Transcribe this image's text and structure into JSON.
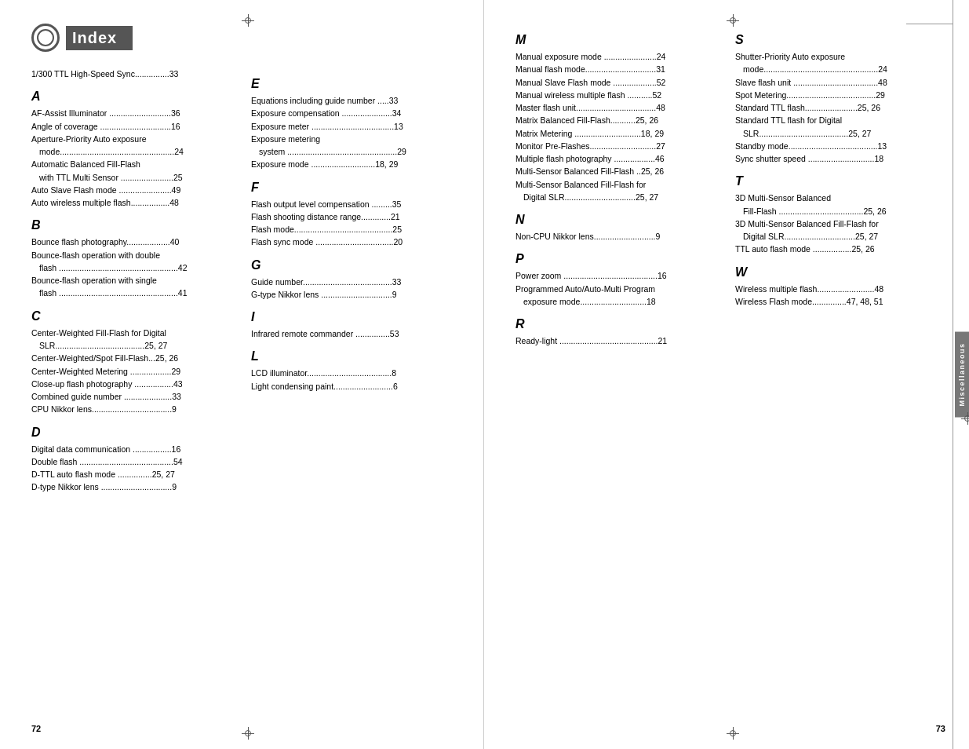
{
  "leftPage": {
    "pageNum": "72",
    "header": {
      "title": "Index",
      "icon": "index-icon"
    },
    "col1": {
      "topEntry": {
        "text": "1/300 TTL High-Speed Sync",
        "page": "33"
      },
      "sections": [
        {
          "letter": "A",
          "entries": [
            {
              "text": "AF-Assist Illuminator ",
              "dots": true,
              "page": "36"
            },
            {
              "text": "Angle of coverage ",
              "dots": true,
              "page": "16"
            },
            {
              "text": "Aperture-Priority Auto exposure mode",
              "dots": true,
              "page": "24",
              "wrap": true
            },
            {
              "text": "Automatic Balanced Fill-Flash with TTL Multi Sensor ",
              "dots": true,
              "page": "25",
              "wrap": true
            },
            {
              "text": "Auto Slave Flash mode ",
              "dots": true,
              "page": "49"
            },
            {
              "text": "Auto wireless multiple flash",
              "dots": true,
              "page": "48"
            }
          ]
        },
        {
          "letter": "B",
          "entries": [
            {
              "text": "Bounce flash photography",
              "dots": true,
              "page": "40"
            },
            {
              "text": "Bounce-flash operation with double flash ",
              "dots": true,
              "page": "42",
              "wrap": true
            },
            {
              "text": "Bounce-flash operation with single flash ",
              "dots": true,
              "page": "41",
              "wrap": true
            }
          ]
        },
        {
          "letter": "C",
          "entries": [
            {
              "text": "Center-Weighted Fill-Flash for Digital SLR",
              "dots": true,
              "page": "25, 27",
              "wrap": true
            },
            {
              "text": "Center-Weighted/Spot Fill-Flash",
              "dots": true,
              "page": "25, 26"
            },
            {
              "text": "Center-Weighted Metering ",
              "dots": true,
              "page": "29"
            },
            {
              "text": "Close-up flash photography ",
              "dots": true,
              "page": "43"
            },
            {
              "text": "Combined guide number ",
              "dots": true,
              "page": "33"
            },
            {
              "text": "CPU Nikkor lens",
              "dots": true,
              "page": "9"
            }
          ]
        },
        {
          "letter": "D",
          "entries": [
            {
              "text": "Digital data communication ",
              "dots": true,
              "page": "16"
            },
            {
              "text": "Double flash ",
              "dots": true,
              "page": "54"
            },
            {
              "text": "D-TTL auto flash mode ",
              "dots": true,
              "page": "25, 27"
            },
            {
              "text": "D-type Nikkor lens ",
              "dots": true,
              "page": "9"
            }
          ]
        }
      ]
    },
    "col2": {
      "sections": [
        {
          "letter": "E",
          "entries": [
            {
              "text": "Equations including guide number ",
              "dots": true,
              "page": "33"
            },
            {
              "text": "Exposure compensation ",
              "dots": true,
              "page": "34"
            },
            {
              "text": "Exposure meter ",
              "dots": true,
              "page": "13"
            },
            {
              "text": "Exposure metering system ",
              "dots": true,
              "page": "29",
              "wrap": true
            },
            {
              "text": "Exposure mode",
              "dots": true,
              "page": "18, 29"
            }
          ]
        },
        {
          "letter": "F",
          "entries": [
            {
              "text": "Flash output level compensation ",
              "dots": true,
              "page": "35"
            },
            {
              "text": "Flash shooting distance range",
              "dots": true,
              "page": "21"
            },
            {
              "text": "Flash mode",
              "dots": true,
              "page": "25"
            },
            {
              "text": "Flash sync mode ",
              "dots": true,
              "page": "20"
            }
          ]
        },
        {
          "letter": "G",
          "entries": [
            {
              "text": "Guide number",
              "dots": true,
              "page": "33"
            },
            {
              "text": "G-type Nikkor lens ",
              "dots": true,
              "page": "9"
            }
          ]
        },
        {
          "letter": "I",
          "entries": [
            {
              "text": "Infrared remote commander ",
              "dots": true,
              "page": "53"
            }
          ]
        },
        {
          "letter": "L",
          "entries": [
            {
              "text": "LCD illuminator",
              "dots": true,
              "page": "8"
            },
            {
              "text": "Light condensing paint",
              "dots": true,
              "page": "6"
            }
          ]
        }
      ]
    }
  },
  "rightPage": {
    "pageNum": "73",
    "miscLabel": "Miscellaneous",
    "col1": {
      "sections": [
        {
          "letter": "M",
          "entries": [
            {
              "text": "Manual exposure mode ",
              "dots": true,
              "page": "24"
            },
            {
              "text": "Manual flash mode",
              "dots": true,
              "page": "31"
            },
            {
              "text": "Manual Slave Flash mode",
              "dots": true,
              "page": "52"
            },
            {
              "text": "Manual wireless multiple flash ",
              "dots": true,
              "page": "52"
            },
            {
              "text": "Master flash unit",
              "dots": true,
              "page": "48"
            },
            {
              "text": "Matrix Balanced Fill-Flash",
              "dots": true,
              "page": "25, 26"
            },
            {
              "text": "Matrix Metering ",
              "dots": true,
              "page": "18, 29"
            },
            {
              "text": "Monitor Pre-Flashes",
              "dots": true,
              "page": "27"
            },
            {
              "text": "Multiple flash photography ",
              "dots": true,
              "page": "46"
            },
            {
              "text": "Multi-Sensor Balanced Fill-Flash ",
              "dots": true,
              "page": "25, 26"
            },
            {
              "text": "Multi-Sensor Balanced Fill-Flash for Digital SLR",
              "dots": true,
              "page": "25, 27",
              "wrap": true
            }
          ]
        },
        {
          "letter": "N",
          "entries": [
            {
              "text": "Non-CPU Nikkor lens",
              "dots": true,
              "page": "9"
            }
          ]
        },
        {
          "letter": "P",
          "entries": [
            {
              "text": "Power zoom ",
              "dots": true,
              "page": "16"
            },
            {
              "text": "Programmed Auto/Auto-Multi Program exposure mode",
              "dots": true,
              "page": "18",
              "wrap": true
            }
          ]
        },
        {
          "letter": "R",
          "entries": [
            {
              "text": "Ready-light ",
              "dots": true,
              "page": "21"
            }
          ]
        }
      ]
    },
    "col2": {
      "sections": [
        {
          "letter": "S",
          "entries": [
            {
              "text": "Shutter-Priority Auto exposure mode",
              "dots": true,
              "page": "24",
              "wrap": true
            },
            {
              "text": "Slave flash unit ",
              "dots": true,
              "page": "48"
            },
            {
              "text": "Spot Metering",
              "dots": true,
              "page": "29"
            },
            {
              "text": "Standard TTL flash",
              "dots": true,
              "page": "25, 26"
            },
            {
              "text": "Standard TTL flash for Digital SLR",
              "dots": true,
              "page": "25, 27",
              "wrap": true
            },
            {
              "text": "Standby mode",
              "dots": true,
              "page": "13"
            },
            {
              "text": "Sync shutter speed ",
              "dots": true,
              "page": "18"
            }
          ]
        },
        {
          "letter": "T",
          "entries": [
            {
              "text": "3D Multi-Sensor Balanced Fill-Flash ",
              "dots": true,
              "page": "25, 26",
              "wrap": true
            },
            {
              "text": "3D Multi-Sensor Balanced Fill-Flash for Digital SLR",
              "dots": true,
              "page": "25, 27",
              "wrap": true
            },
            {
              "text": "TTL auto flash mode ",
              "dots": true,
              "page": "25, 26"
            }
          ]
        },
        {
          "letter": "W",
          "entries": [
            {
              "text": "Wireless multiple flash",
              "dots": true,
              "page": "48"
            },
            {
              "text": "Wireless Flash mode",
              "dots": true,
              "page": "47, 48, 51"
            }
          ]
        }
      ]
    }
  }
}
